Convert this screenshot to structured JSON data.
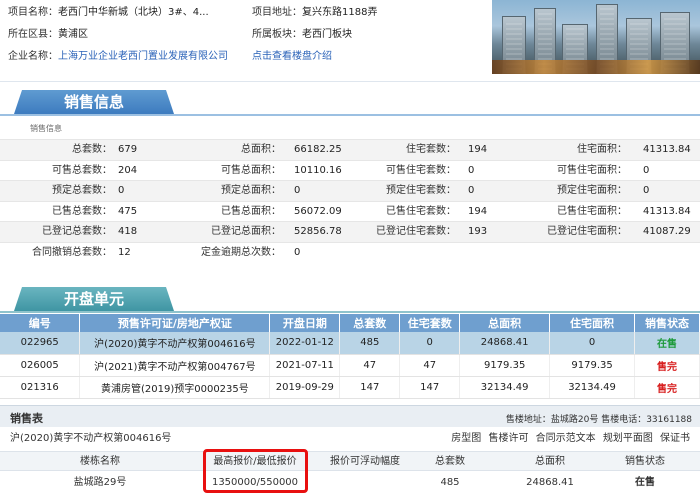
{
  "header": {
    "left": [
      {
        "k": "项目名称：",
        "v": "老西门中华新城（北块）3#、4..."
      },
      {
        "k": "所在区县：",
        "v": "黄浦区"
      },
      {
        "k": "企业名称：",
        "v": "上海万业企业老西门置业发展有限公司"
      }
    ],
    "right": [
      {
        "k": "项目地址：",
        "v": "复兴东路1188弄"
      },
      {
        "k": "所属板块：",
        "v": "老西门板块"
      },
      {
        "k": "",
        "v": "点击查看楼盘介绍"
      }
    ]
  },
  "sales_info": {
    "tab": "销售信息",
    "caption": "销售信息",
    "rows": [
      [
        "总套数：",
        "679",
        "总面积：",
        "66182.25",
        "住宅套数：",
        "194",
        "住宅面积：",
        "41313.84"
      ],
      [
        "可售总套数：",
        "204",
        "可售总面积：",
        "10110.16",
        "可售住宅套数：",
        "0",
        "可售住宅面积：",
        "0"
      ],
      [
        "预定总套数：",
        "0",
        "预定总面积：",
        "0",
        "预定住宅套数：",
        "0",
        "预定住宅面积：",
        "0"
      ],
      [
        "已售总套数：",
        "475",
        "已售总面积：",
        "56072.09",
        "已售住宅套数：",
        "194",
        "已售住宅面积：",
        "41313.84"
      ],
      [
        "已登记总套数：",
        "418",
        "已登记总面积：",
        "52856.78",
        "已登记住宅套数：",
        "193",
        "已登记住宅面积：",
        "41087.29"
      ],
      [
        "合同撤销总套数：",
        "12",
        "定金逾期总次数：",
        "0",
        "",
        "",
        "",
        ""
      ]
    ]
  },
  "opening": {
    "tab": "开盘单元",
    "headers": [
      "编号",
      "预售许可证/房地产权证",
      "开盘日期",
      "总套数",
      "住宅套数",
      "总面积",
      "住宅面积",
      "销售状态"
    ],
    "rows": [
      [
        "022965",
        "沪(2020)黄字不动产权第004616号",
        "2022-01-12",
        "485",
        "0",
        "24868.41",
        "0",
        "在售"
      ],
      [
        "026005",
        "沪(2021)黄字不动产权第004767号",
        "2021-07-11",
        "47",
        "47",
        "9179.35",
        "9179.35",
        "售完"
      ],
      [
        "021316",
        "黄浦房管(2019)预字0000235号",
        "2019-09-29",
        "147",
        "147",
        "32134.49",
        "32134.49",
        "售完"
      ]
    ]
  },
  "sales_table": {
    "title": "销售表",
    "address": "售楼地址：盐城路20号 售楼电话：33161188",
    "permit": "沪(2020)黄字不动产权第004616号",
    "links": "房型图 售楼许可 合同示范文本 规划平面图 保证书",
    "headers": [
      "楼栋名称",
      "最高报价/最低报价",
      "报价可浮动幅度",
      "总套数",
      "总面积",
      "销售状态"
    ],
    "row": [
      "盐城路29号",
      "1350000/550000",
      "",
      "485",
      "24868.41",
      "在售"
    ]
  }
}
